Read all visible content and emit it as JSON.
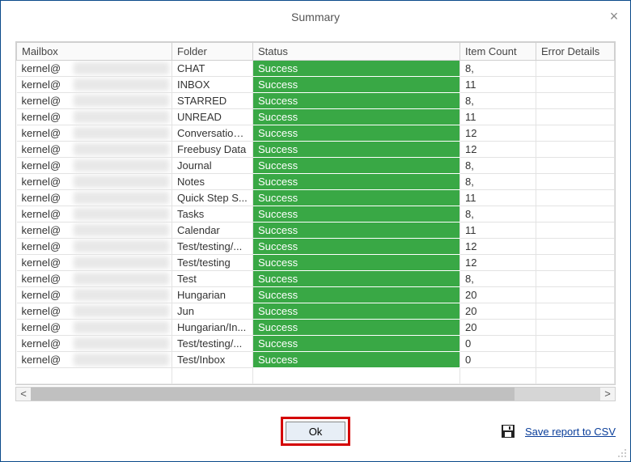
{
  "title": "Summary",
  "close_glyph": "×",
  "columns": {
    "mailbox": "Mailbox",
    "folder": "Folder",
    "status": "Status",
    "item_count": "Item Count",
    "error_details": "Error Details"
  },
  "rows": [
    {
      "mailbox": "kernel@",
      "folder": "CHAT",
      "status": "Success",
      "item_count": "8,",
      "error_details": ""
    },
    {
      "mailbox": "kernel@",
      "folder": "INBOX",
      "status": "Success",
      "item_count": "11",
      "error_details": ""
    },
    {
      "mailbox": "kernel@",
      "folder": "STARRED",
      "status": "Success",
      "item_count": "8,",
      "error_details": ""
    },
    {
      "mailbox": "kernel@",
      "folder": "UNREAD",
      "status": "Success",
      "item_count": "11",
      "error_details": ""
    },
    {
      "mailbox": "kernel@",
      "folder": "Conversation...",
      "status": "Success",
      "item_count": "12",
      "error_details": ""
    },
    {
      "mailbox": "kernel@",
      "folder": "Freebusy Data",
      "status": "Success",
      "item_count": "12",
      "error_details": ""
    },
    {
      "mailbox": "kernel@",
      "folder": "Journal",
      "status": "Success",
      "item_count": "8,",
      "error_details": ""
    },
    {
      "mailbox": "kernel@",
      "folder": "Notes",
      "status": "Success",
      "item_count": "8,",
      "error_details": ""
    },
    {
      "mailbox": "kernel@",
      "folder": "Quick Step S...",
      "status": "Success",
      "item_count": "11",
      "error_details": ""
    },
    {
      "mailbox": "kernel@",
      "folder": "Tasks",
      "status": "Success",
      "item_count": "8,",
      "error_details": ""
    },
    {
      "mailbox": "kernel@",
      "folder": "Calendar",
      "status": "Success",
      "item_count": "11",
      "error_details": ""
    },
    {
      "mailbox": "kernel@",
      "folder": "Test/testing/...",
      "status": "Success",
      "item_count": "12",
      "error_details": ""
    },
    {
      "mailbox": "kernel@",
      "folder": "Test/testing",
      "status": "Success",
      "item_count": "12",
      "error_details": ""
    },
    {
      "mailbox": "kernel@",
      "folder": "Test",
      "status": "Success",
      "item_count": "8,",
      "error_details": ""
    },
    {
      "mailbox": "kernel@",
      "folder": "Hungarian",
      "status": "Success",
      "item_count": "20",
      "error_details": ""
    },
    {
      "mailbox": "kernel@",
      "folder": "Jun",
      "status": "Success",
      "item_count": "20",
      "error_details": ""
    },
    {
      "mailbox": "kernel@",
      "folder": "Hungarian/In...",
      "status": "Success",
      "item_count": "20",
      "error_details": ""
    },
    {
      "mailbox": "kernel@",
      "folder": "Test/testing/...",
      "status": "Success",
      "item_count": "0",
      "error_details": ""
    },
    {
      "mailbox": "kernel@",
      "folder": "Test/Inbox",
      "status": "Success",
      "item_count": "0",
      "error_details": ""
    }
  ],
  "scroll": {
    "left_glyph": "<",
    "right_glyph": ">"
  },
  "buttons": {
    "ok": "Ok",
    "save_csv": "Save report to CSV"
  },
  "icons": {
    "disk": "disk-icon"
  }
}
